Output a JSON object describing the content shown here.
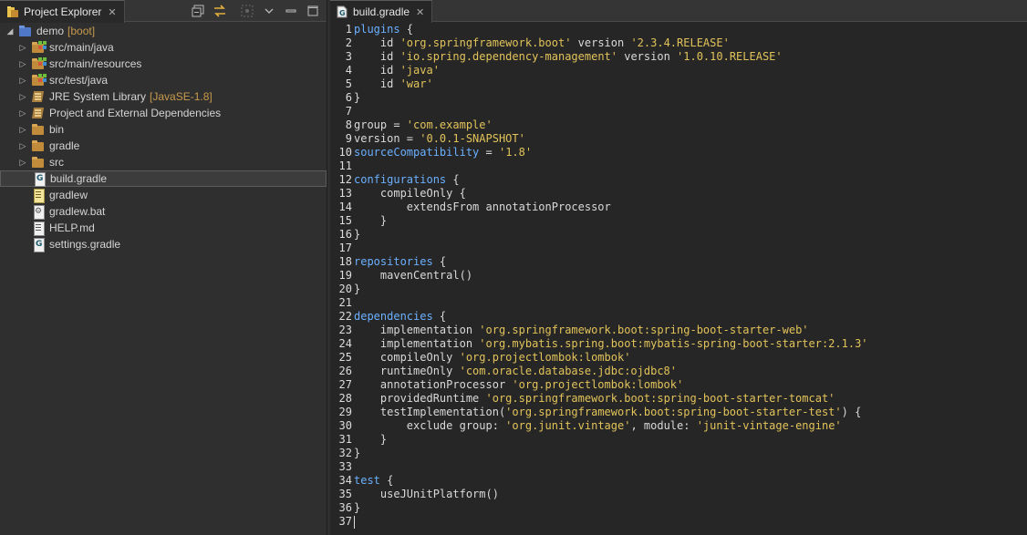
{
  "explorer": {
    "tab_label": "Project Explorer",
    "tab_close": "✕",
    "tree": [
      {
        "label": "demo",
        "decoration": "[boot]",
        "kind": "project",
        "expanded": true,
        "depth": 0
      },
      {
        "label": "src/main/java",
        "decoration": "",
        "kind": "pkgfolder",
        "depth": 1
      },
      {
        "label": "src/main/resources",
        "decoration": "",
        "kind": "pkgfolder",
        "depth": 1
      },
      {
        "label": "src/test/java",
        "decoration": "",
        "kind": "pkgfolder",
        "depth": 1
      },
      {
        "label": "JRE System Library",
        "decoration": "[JavaSE-1.8]",
        "kind": "jar",
        "depth": 1
      },
      {
        "label": "Project and External Dependencies",
        "decoration": "",
        "kind": "jar",
        "depth": 1
      },
      {
        "label": "bin",
        "decoration": "",
        "kind": "folder",
        "depth": 1
      },
      {
        "label": "gradle",
        "decoration": "",
        "kind": "folder",
        "depth": 1
      },
      {
        "label": "src",
        "decoration": "",
        "kind": "folder",
        "depth": 1
      },
      {
        "label": "build.gradle",
        "decoration": "",
        "kind": "gradle-file",
        "depth": 1,
        "selected": true
      },
      {
        "label": "gradlew",
        "decoration": "",
        "kind": "script-file",
        "depth": 1
      },
      {
        "label": "gradlew.bat",
        "decoration": "",
        "kind": "bat-file",
        "depth": 1
      },
      {
        "label": "HELP.md",
        "decoration": "",
        "kind": "md-file",
        "depth": 1
      },
      {
        "label": "settings.gradle",
        "decoration": "",
        "kind": "gradle-file",
        "depth": 1
      }
    ]
  },
  "editor": {
    "tab_label": "build.gradle",
    "tab_close": "✕",
    "lines": [
      [
        [
          "kw",
          "plugins"
        ],
        [
          "txt",
          " {"
        ]
      ],
      [
        [
          "txt",
          "    id "
        ],
        [
          "str",
          "'org.springframework.boot'"
        ],
        [
          "txt",
          " version "
        ],
        [
          "str",
          "'2.3.4.RELEASE'"
        ]
      ],
      [
        [
          "txt",
          "    id "
        ],
        [
          "str",
          "'io.spring.dependency-management'"
        ],
        [
          "txt",
          " version "
        ],
        [
          "str",
          "'1.0.10.RELEASE'"
        ]
      ],
      [
        [
          "txt",
          "    id "
        ],
        [
          "str",
          "'java'"
        ]
      ],
      [
        [
          "txt",
          "    id "
        ],
        [
          "str",
          "'war'"
        ]
      ],
      [
        [
          "txt",
          "}"
        ]
      ],
      [
        [
          "txt",
          ""
        ]
      ],
      [
        [
          "txt",
          "group = "
        ],
        [
          "str",
          "'com.example'"
        ]
      ],
      [
        [
          "txt",
          "version = "
        ],
        [
          "str",
          "'0.0.1-SNAPSHOT'"
        ]
      ],
      [
        [
          "kw",
          "sourceCompatibility"
        ],
        [
          "txt",
          " = "
        ],
        [
          "str",
          "'1.8'"
        ]
      ],
      [
        [
          "txt",
          ""
        ]
      ],
      [
        [
          "kw",
          "configurations"
        ],
        [
          "txt",
          " {"
        ]
      ],
      [
        [
          "txt",
          "    compileOnly {"
        ]
      ],
      [
        [
          "txt",
          "        extendsFrom annotationProcessor"
        ]
      ],
      [
        [
          "txt",
          "    }"
        ]
      ],
      [
        [
          "txt",
          "}"
        ]
      ],
      [
        [
          "txt",
          ""
        ]
      ],
      [
        [
          "kw",
          "repositories"
        ],
        [
          "txt",
          " {"
        ]
      ],
      [
        [
          "txt",
          "    mavenCentral()"
        ]
      ],
      [
        [
          "txt",
          "}"
        ]
      ],
      [
        [
          "txt",
          ""
        ]
      ],
      [
        [
          "kw",
          "dependencies"
        ],
        [
          "txt",
          " {"
        ]
      ],
      [
        [
          "txt",
          "    implementation "
        ],
        [
          "str",
          "'org.springframework.boot:spring-boot-starter-web'"
        ]
      ],
      [
        [
          "txt",
          "    implementation "
        ],
        [
          "str",
          "'org.mybatis.spring.boot:mybatis-spring-boot-starter:2.1.3'"
        ]
      ],
      [
        [
          "txt",
          "    compileOnly "
        ],
        [
          "str",
          "'org.projectlombok:lombok'"
        ]
      ],
      [
        [
          "txt",
          "    runtimeOnly "
        ],
        [
          "str",
          "'com.oracle.database.jdbc:ojdbc8'"
        ]
      ],
      [
        [
          "txt",
          "    annotationProcessor "
        ],
        [
          "str",
          "'org.projectlombok:lombok'"
        ]
      ],
      [
        [
          "txt",
          "    providedRuntime "
        ],
        [
          "str",
          "'org.springframework.boot:spring-boot-starter-tomcat'"
        ]
      ],
      [
        [
          "txt",
          "    testImplementation("
        ],
        [
          "str",
          "'org.springframework.boot:spring-boot-starter-test'"
        ],
        [
          "txt",
          ") {"
        ]
      ],
      [
        [
          "txt",
          "        exclude group: "
        ],
        [
          "str",
          "'org.junit.vintage'"
        ],
        [
          "txt",
          ", module: "
        ],
        [
          "str",
          "'junit-vintage-engine'"
        ]
      ],
      [
        [
          "txt",
          "    }"
        ]
      ],
      [
        [
          "txt",
          "}"
        ]
      ],
      [
        [
          "txt",
          ""
        ]
      ],
      [
        [
          "kw",
          "test"
        ],
        [
          "txt",
          " {"
        ]
      ],
      [
        [
          "txt",
          "    useJUnitPlatform()"
        ]
      ],
      [
        [
          "txt",
          "}"
        ]
      ],
      [
        [
          "txt",
          ""
        ]
      ]
    ]
  }
}
